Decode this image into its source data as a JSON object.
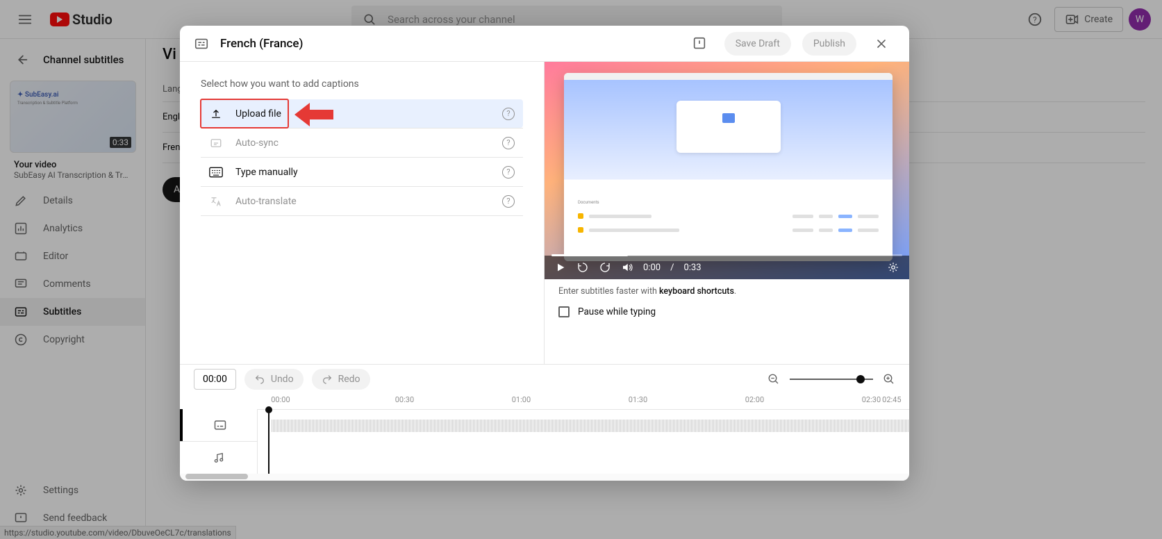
{
  "topbar": {
    "logo_text": "Studio",
    "search_placeholder": "Search across your channel",
    "create_label": "Create",
    "avatar_initial": "W"
  },
  "back_pane": {
    "header": "Channel subtitles",
    "thumb_duration": "0:33",
    "your_video_title": "Your video",
    "your_video_sub": "SubEasy AI Transcription & Translati...",
    "nav": {
      "details": "Details",
      "analytics": "Analytics",
      "editor": "Editor",
      "comments": "Comments",
      "subtitles": "Subtitles",
      "copyright": "Copyright",
      "settings": "Settings",
      "feedback": "Send feedback"
    }
  },
  "main": {
    "title_partial": "Vi",
    "lang_header": "Language",
    "lang_en": "Englis",
    "lang_fr": "Frenc",
    "add_label": "Ad"
  },
  "dialog": {
    "title": "French (France)",
    "save_draft": "Save Draft",
    "publish": "Publish",
    "prompt": "Select how you want to add captions",
    "options": {
      "upload": "Upload file",
      "autosync": "Auto-sync",
      "manual": "Type manually",
      "autotranslate": "Auto-translate"
    },
    "hint_prefix": "Enter subtitles faster with ",
    "hint_bold": "keyboard shortcuts",
    "hint_suffix": ".",
    "pause_label": "Pause while typing",
    "player": {
      "time_current": "0:00",
      "time_sep": " / ",
      "time_total": "0:33"
    },
    "footer": {
      "time_chip": "00:00",
      "undo": "Undo",
      "redo": "Redo"
    },
    "timeline": {
      "labels": [
        "00:00",
        "00:30",
        "01:00",
        "01:30",
        "02:00",
        "02:30",
        "02:45"
      ],
      "positions_pct": [
        12.5,
        33,
        50,
        67,
        83.5,
        95,
        100
      ]
    }
  },
  "status_url": "https://studio.youtube.com/video/DbuveOeCL7c/translations"
}
